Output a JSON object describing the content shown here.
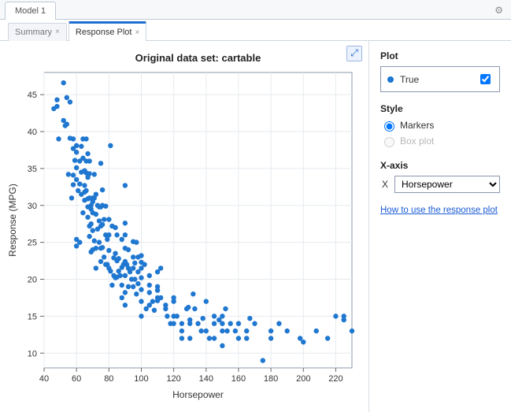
{
  "window": {
    "title": "Model 1",
    "gear_icon": "gear-icon"
  },
  "tabs": {
    "items": [
      {
        "label": "Summary",
        "active": false
      },
      {
        "label": "Response Plot",
        "active": true
      }
    ]
  },
  "panel": {
    "plot_header": "Plot",
    "legend_label": "True",
    "legend_checked": true,
    "style_header": "Style",
    "style_options": {
      "markers": "Markers",
      "boxplot": "Box plot"
    },
    "style_selected": "markers",
    "xaxis_header": "X-axis",
    "xaxis_prefix": "X",
    "xaxis_options": [
      "Horsepower"
    ],
    "xaxis_selected": "Horsepower",
    "help_link": "How to use the response plot"
  },
  "chart_data": {
    "type": "scatter",
    "title": "Original data set: cartable",
    "xlabel": "Horsepower",
    "ylabel": "Response (MPG)",
    "xlim": [
      40,
      230
    ],
    "ylim": [
      8,
      48
    ],
    "xticks": [
      40,
      60,
      80,
      100,
      120,
      140,
      160,
      180,
      200,
      220
    ],
    "yticks": [
      10,
      15,
      20,
      25,
      30,
      35,
      40,
      45
    ],
    "series": [
      {
        "name": "True",
        "color": "#1f77d0",
        "x": [
          46,
          48,
          48,
          49,
          52,
          52,
          53,
          54,
          54,
          55,
          56,
          56,
          57,
          58,
          58,
          58,
          58,
          59,
          60,
          60,
          60,
          60,
          60,
          60,
          61,
          62,
          62,
          62,
          63,
          63,
          63,
          64,
          64,
          64,
          65,
          65,
          65,
          65,
          66,
          66,
          66,
          66,
          67,
          67,
          67,
          67,
          67,
          68,
          68,
          68,
          68,
          68,
          69,
          69,
          69,
          69,
          70,
          70,
          70,
          70,
          70,
          71,
          71,
          71,
          72,
          72,
          72,
          72,
          73,
          73,
          74,
          74,
          74,
          75,
          75,
          75,
          75,
          75,
          76,
          76,
          76,
          76,
          77,
          77,
          78,
          78,
          78,
          79,
          79,
          80,
          80,
          80,
          80,
          81,
          81,
          82,
          82,
          83,
          83,
          84,
          84,
          84,
          85,
          85,
          85,
          86,
          86,
          87,
          88,
          88,
          88,
          88,
          89,
          90,
          90,
          90,
          90,
          90,
          90,
          90,
          90,
          91,
          92,
          92,
          92,
          93,
          94,
          95,
          95,
          95,
          95,
          96,
          96,
          97,
          97,
          98,
          98,
          98,
          100,
          100,
          100,
          100,
          100,
          100,
          100,
          102,
          103,
          105,
          105,
          105,
          105,
          107,
          108,
          110,
          110,
          110,
          110,
          110,
          112,
          112,
          115,
          115,
          116,
          118,
          120,
          120,
          120,
          120,
          122,
          125,
          125,
          125,
          128,
          129,
          130,
          130,
          130,
          132,
          133,
          135,
          137,
          138,
          140,
          140,
          142,
          145,
          145,
          145,
          148,
          150,
          150,
          150,
          150,
          152,
          153,
          155,
          158,
          160,
          160,
          165,
          165,
          167,
          170,
          175,
          180,
          180,
          185,
          190,
          198,
          200,
          208,
          215,
          220,
          225,
          225,
          230
        ],
        "y": [
          43.1,
          43.4,
          44.3,
          39,
          46.6,
          41.5,
          40.8,
          44.6,
          41,
          34.2,
          44,
          39.1,
          31,
          37.7,
          34.1,
          32.8,
          39,
          36.1,
          38.1,
          37.2,
          35.1,
          33.5,
          25.4,
          24.5,
          32,
          36,
          32.9,
          25,
          38,
          34.5,
          31.5,
          39,
          36.4,
          29,
          34.7,
          32.7,
          31.8,
          30.7,
          39,
          36,
          34.4,
          32,
          37,
          33.8,
          30.9,
          28.4,
          29.8,
          36,
          34.3,
          31,
          27.2,
          25.8,
          30,
          29.5,
          27.5,
          23.7,
          31,
          30.5,
          29,
          26.6,
          24,
          34.2,
          31,
          25.2,
          31.5,
          28.8,
          24.2,
          21.5,
          30,
          26.8,
          29.8,
          27.9,
          25,
          35.7,
          29.8,
          27.2,
          24.2,
          22.4,
          32.1,
          30,
          27.4,
          24.3,
          28.1,
          23,
          29.9,
          26,
          22,
          25.4,
          22,
          28.1,
          23.9,
          21.5,
          26,
          38.1,
          21.1,
          27.2,
          19.2,
          22.9,
          20.5,
          27,
          23.5,
          20.2,
          26,
          22.5,
          20.3,
          22.8,
          21.1,
          20.5,
          25.4,
          21.6,
          19.2,
          17.5,
          22,
          32.7,
          27.6,
          26,
          24.2,
          22.4,
          20.5,
          18.2,
          16.5,
          22,
          24,
          21.5,
          19,
          21,
          20,
          25.1,
          23,
          21.5,
          19,
          22.2,
          20,
          25,
          18,
          23,
          19.4,
          21,
          22.3,
          23.2,
          21.5,
          20.2,
          18.6,
          17,
          15,
          22,
          16,
          19.2,
          20.5,
          18.2,
          16.5,
          17,
          15.8,
          17.1,
          21,
          18.5,
          19,
          17.5,
          21.5,
          17.5,
          16.5,
          16,
          15,
          14,
          15,
          17,
          14,
          17.5,
          15,
          14,
          12,
          13,
          16,
          16.2,
          14,
          12,
          14.5,
          18,
          16,
          14,
          13,
          14.7,
          17,
          13,
          12,
          14,
          12,
          15,
          14.5,
          11,
          14,
          15,
          13,
          16,
          13,
          14,
          13,
          12,
          14,
          12,
          13,
          14.7,
          14,
          9,
          13,
          12,
          14,
          13,
          12,
          11.5,
          13,
          12,
          15,
          14.5,
          15,
          13
        ],
        "marker": "circle"
      }
    ]
  }
}
